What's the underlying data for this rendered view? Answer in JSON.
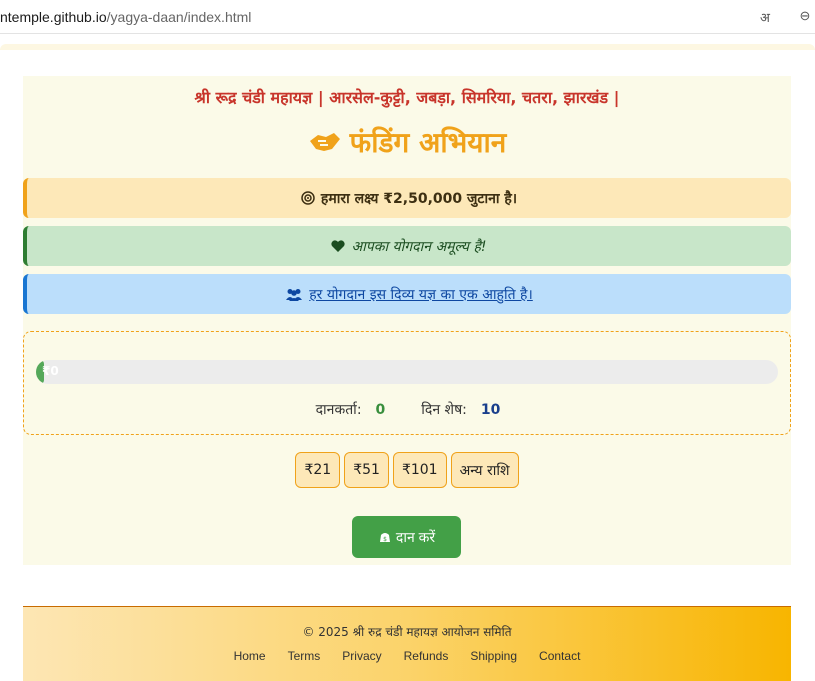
{
  "browser": {
    "url_host": "ntemple.github.io",
    "url_path": "/yagya-daan/index.html",
    "reader_icon": "अ",
    "zoom_icon": "⊖"
  },
  "header": {
    "subtitle": "श्री रूद्र चंडी महायज्ञ | आरसेल-कुट्टी, जबड़ा, सिमरिया, चतरा, झारखंड |",
    "title": "फंडिंग अभियान"
  },
  "alerts": {
    "goal": "हमारा लक्ष्य ₹2,50,000 जुटाना है।",
    "thanks": "आपका योगदान अमूल्य है!",
    "info": "हर योगदान इस दिव्य यज्ञ का एक आहुति है।"
  },
  "progress": {
    "label": "₹0",
    "fraction": 0.0,
    "donors_label": "दानकर्ता:",
    "donors_value": "0",
    "days_label": "दिन शेष:",
    "days_value": "10"
  },
  "amounts": [
    "₹21",
    "₹51",
    "₹101",
    "अन्य राशि"
  ],
  "donate_label": "दान करें",
  "footer": {
    "copyright": "© 2025 श्री रुद्र चंडी महायज्ञ आयोजन समिति",
    "links": [
      "Home",
      "Terms",
      "Privacy",
      "Refunds",
      "Shipping",
      "Contact"
    ]
  },
  "colors": {
    "accent": "#f0a21a",
    "heading_red": "#c8352b",
    "success": "#43a047",
    "info": "#1976d2"
  }
}
